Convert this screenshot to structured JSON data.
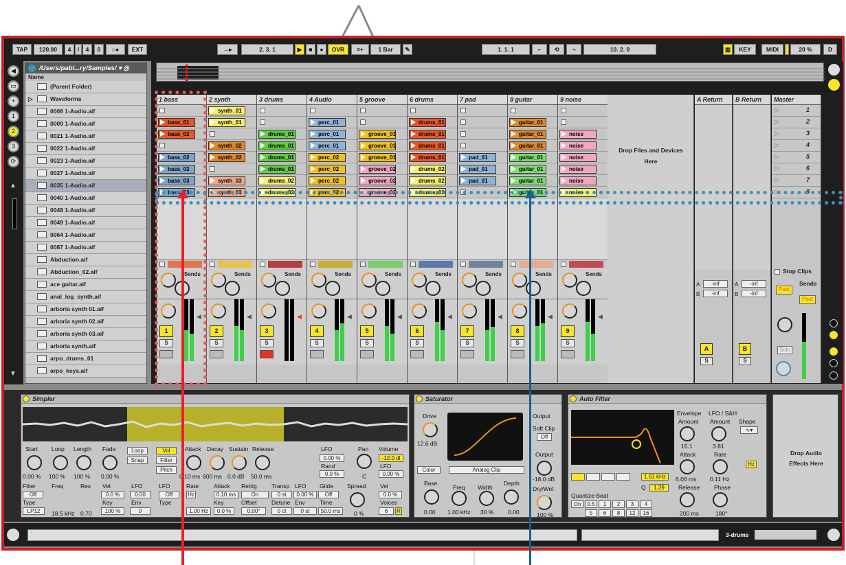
{
  "transport": {
    "tap": "TAP",
    "tempo": "120.00",
    "sig_num": "4",
    "sig_slash": "/",
    "sig_den": "4",
    "metro": "0",
    "ext": "EXT",
    "position": "2.  3.  1",
    "ovr": "OVR",
    "quant": "1 Bar",
    "loop_start": "1.  1.  1",
    "loop_len": "10.  2.  0",
    "key": "KEY",
    "midi": "MIDI",
    "cpu": "20 %",
    "d": "D"
  },
  "browser": {
    "path": "/Users/pabl...ry/Samples/",
    "name_header": "Name",
    "parent": "(Parent Folder)",
    "folder": "Waveforms",
    "files": [
      "0008 1-Audio.aif",
      "0009 1-Audio.aif",
      "0021 1-Audio.aif",
      "0022 1-Audio.aif",
      "0023 1-Audio.aif",
      "0027 1-Audio.aif",
      "0035 1-Audio.aif",
      "0040 1-Audio.aif",
      "0048 1-Audio.aif",
      "0049 1-Audio.aif",
      "0064 1-Audio.aif",
      "0087 1-Audio.aif",
      "Abduction.aif",
      "Abduction_02.aif",
      "ace guitar.aif",
      "anal_log_synth.aif",
      "arboria synth 01.aif",
      "arboria synth 02.aif",
      "arboria synth 03.aif",
      "arboria synth.aif",
      "arpo_drums_01",
      "arpo_keys.aif"
    ]
  },
  "tracks": [
    {
      "name": "1 bass",
      "num": "1",
      "color": "#e8572a",
      "clips": [
        "",
        "bass_01",
        "bass_02",
        "",
        "bass_02",
        "bass_02",
        "bass_03",
        "bass_03"
      ],
      "clipcolors": [
        "",
        "#e8572a",
        "#e8572a",
        "",
        "#7fa3c9",
        "#7fa3c9",
        "#7fa3c9",
        "#7fa3c9"
      ]
    },
    {
      "name": "2 synth",
      "num": "2",
      "color": "#f0c020",
      "clips": [
        "synth_01",
        "synth_01",
        "",
        "synth_02",
        "synth_02",
        "",
        "synth_03",
        "synth_03"
      ],
      "clipcolors": [
        "#f9ef6e",
        "#f9ef6e",
        "",
        "#e0882e",
        "#e0882e",
        "",
        "#f1a98a",
        "#f1a98a"
      ]
    },
    {
      "name": "3 drums",
      "num": "3",
      "color": "#a11",
      "clips": [
        "",
        "",
        "drums_01",
        "drums_01",
        "drums_01",
        "drums_01",
        "drums_02",
        "drums_02"
      ],
      "clipcolors": [
        "",
        "",
        "#5fce45",
        "#5fce45",
        "#5fce45",
        "#5fce45",
        "#f9ef6e",
        "#f9ef6e"
      ]
    },
    {
      "name": "4 Audio",
      "num": "4",
      "color": "#caa10b",
      "clips": [
        "",
        "perc_01",
        "perc_01",
        "perc_01",
        "perc_02",
        "perc_02",
        "perc_02",
        "perc_02"
      ],
      "clipcolors": [
        "",
        "#8fb3d6",
        "#8fb3d6",
        "#8fb3d6",
        "#f0c020",
        "#f0c020",
        "#f0c020",
        "#f0c020"
      ]
    },
    {
      "name": "5 groove",
      "num": "5",
      "color": "#5fce45",
      "clips": [
        "",
        "",
        "groove_01",
        "groove_01",
        "groove_01",
        "groove_02",
        "groove_02",
        "groove_02"
      ],
      "clipcolors": [
        "",
        "",
        "#f0c020",
        "#f0c020",
        "#f0c020",
        "#f1a6c0",
        "#f1a6c0",
        "#f1a6c0"
      ]
    },
    {
      "name": "6 drums",
      "num": "6",
      "color": "#3a5ea0",
      "clips": [
        "",
        "drums_01",
        "drums_01",
        "drums_01",
        "drums_01",
        "drums_02",
        "drums_02",
        "drums_02"
      ],
      "clipcolors": [
        "",
        "#e8572a",
        "#e8572a",
        "#e8572a",
        "#e8572a",
        "#f9ef6e",
        "#f9ef6e",
        "#f9ef6e"
      ]
    },
    {
      "name": "7 pad",
      "num": "7",
      "color": "#556b8f",
      "clips": [
        "",
        "",
        "",
        "",
        "pad_01",
        "pad_01",
        "pad_01",
        ""
      ],
      "clipcolors": [
        "",
        "",
        "",
        "",
        "#8fb3d6",
        "#8fb3d6",
        "#8fb3d6",
        ""
      ]
    },
    {
      "name": "8 guitar",
      "num": "8",
      "color": "#f0a080",
      "clips": [
        "",
        "guitar_01",
        "guitar_01",
        "guitar_01",
        "guitar_01",
        "guitar_01",
        "guitar_01",
        "guitar_01"
      ],
      "clipcolors": [
        "",
        "#e0882e",
        "#e0882e",
        "#e0882e",
        "#7fdc73",
        "#7fdc73",
        "#7fdc73",
        "#7fdc73"
      ]
    },
    {
      "name": "9 noise",
      "num": "9",
      "color": "#c0202a",
      "clips": [
        "",
        "",
        "noise",
        "noise",
        "noise",
        "noise",
        "noise",
        "noise"
      ],
      "clipcolors": [
        "",
        "",
        "#f1a6c0",
        "#f1a6c0",
        "#f1a6c0",
        "#f1a6c0",
        "#f1a6c0",
        "#f9ef6e"
      ]
    }
  ],
  "dropzone": {
    "line1": "Drop Files and Devices",
    "line2": "Here"
  },
  "returns": [
    {
      "name": "A Return",
      "btn": "A"
    },
    {
      "name": "B Return",
      "btn": "B"
    }
  ],
  "master": {
    "name": "Master",
    "scenes": [
      "1",
      "2",
      "3",
      "4",
      "5",
      "6",
      "7",
      "8"
    ],
    "stop_clips": "Stop Clips",
    "post": "Post",
    "solo": "Solo"
  },
  "sends_label": "Sends",
  "return_sends": {
    "a": "A",
    "b": "B",
    "val": "-inf"
  },
  "simpler": {
    "title": "Simpler",
    "start": "Start",
    "loop": "Loop",
    "length": "Length",
    "fade": "Fade",
    "loop_btn": "Loop",
    "snap_btn": "Snap",
    "start_v": "0.00 %",
    "loop_v": "100 %",
    "length_v": "100 %",
    "fade_v": "0.00 %",
    "vol": "Vol",
    "filter": "Filter",
    "pitch": "Pitch",
    "attack": "Attack",
    "decay": "Decay",
    "sustain": "Sustain",
    "release": "Release",
    "attack_v": "0.10 ms",
    "decay_v": "600 ms",
    "sustain_v": "0.0 dB",
    "release_v": "50.0 ms",
    "lfo": "LFO",
    "lfo_v": "0.00 %",
    "rand": "Rand",
    "rand_v": "0.0 %",
    "pan": "Pan",
    "pan_v": "C",
    "volume": "Volume",
    "volume_v": "-12.0 dl",
    "lfo2": "LFO",
    "lfo2_v": "0.00 %",
    "filter_l": "Filter",
    "filter_off": "Off",
    "type": "Type",
    "type_v": "LP12",
    "freq": "Freq",
    "freq_v": "18.5 kHz",
    "res": "Res",
    "res_v": "0.70",
    "vel": "Vel",
    "vel_v": "0.0 %",
    "key": "Key",
    "key_v": "100 %",
    "lfo3": "LFO",
    "lfo3_v": "0.00",
    "env": "Env",
    "env_v": "0",
    "lfo_l": "LFO",
    "lfo_off": "Off",
    "rate": "Rate",
    "hz": "Hz",
    "rate_v": "1.00 Hz",
    "attack2": "Attack",
    "attack2_v": "0.10 ms",
    "retrig": "Retrig",
    "retrig_on": "On",
    "offset": "Offset",
    "offset_v": "0.00°",
    "key2": "Key",
    "key2_v": "0.0 %",
    "transp": "Transp",
    "transp_v": "0 st",
    "detune": "Detune",
    "detune_v": "0 ct",
    "lfo4": "LFO",
    "lfo4_v": "0.00 %",
    "glide": "Glide",
    "glide_v": "Off",
    "env2": "Env",
    "env2_v": "0 st",
    "time": "Time",
    "time_v": "50.0 ms",
    "spread": "Spread",
    "spread_v": "0 %",
    "vel2": "Vel",
    "vel2_v": "0.0 %",
    "voices": "Voices",
    "voices_v": "6",
    "r": "R"
  },
  "saturator": {
    "title": "Saturator",
    "drive": "Drive",
    "drive_v": "12.6 dB",
    "color": "Color",
    "mode": "Analog Clip",
    "base": "Base",
    "base_v": "0.00",
    "freq": "Freq",
    "freq_v": "1.00 kHz",
    "width": "Width",
    "width_v": "30 %",
    "depth": "Depth",
    "depth_v": "0.00",
    "output": "Output",
    "soft_clip": "Soft Clip",
    "off": "Off",
    "output2": "Output",
    "output_v": "-18.0 dB",
    "drywet": "Dry/Wet",
    "drywet_v": "100 %"
  },
  "autofilter": {
    "title": "Auto Filter",
    "freq_v": "1.61 kHz",
    "q": "Q",
    "q_v": "1.39",
    "quant_beat": "Quantize Beat",
    "on": "On",
    "qvals": [
      "0.5",
      "1",
      "2",
      "3",
      "4",
      "5",
      "6",
      "8",
      "12",
      "16"
    ],
    "envelope": "Envelope",
    "amount": "Amount",
    "amount_v": "15.1",
    "attack": "Attack",
    "attack_v": "6.00 ms",
    "release": "Release",
    "release_v": "200 ms",
    "lfo": "LFO / S&H",
    "amount2": "Amount",
    "amount2_v": "3.81",
    "shape": "Shape",
    "rate": "Rate",
    "rate_v": "0.11 Hz",
    "hz": "Hz",
    "phase": "Phase",
    "phase_v": "180°"
  },
  "drop_audio": {
    "line1": "Drop Audio",
    "line2": "Effects Here"
  },
  "status": {
    "track": "3-drums"
  }
}
